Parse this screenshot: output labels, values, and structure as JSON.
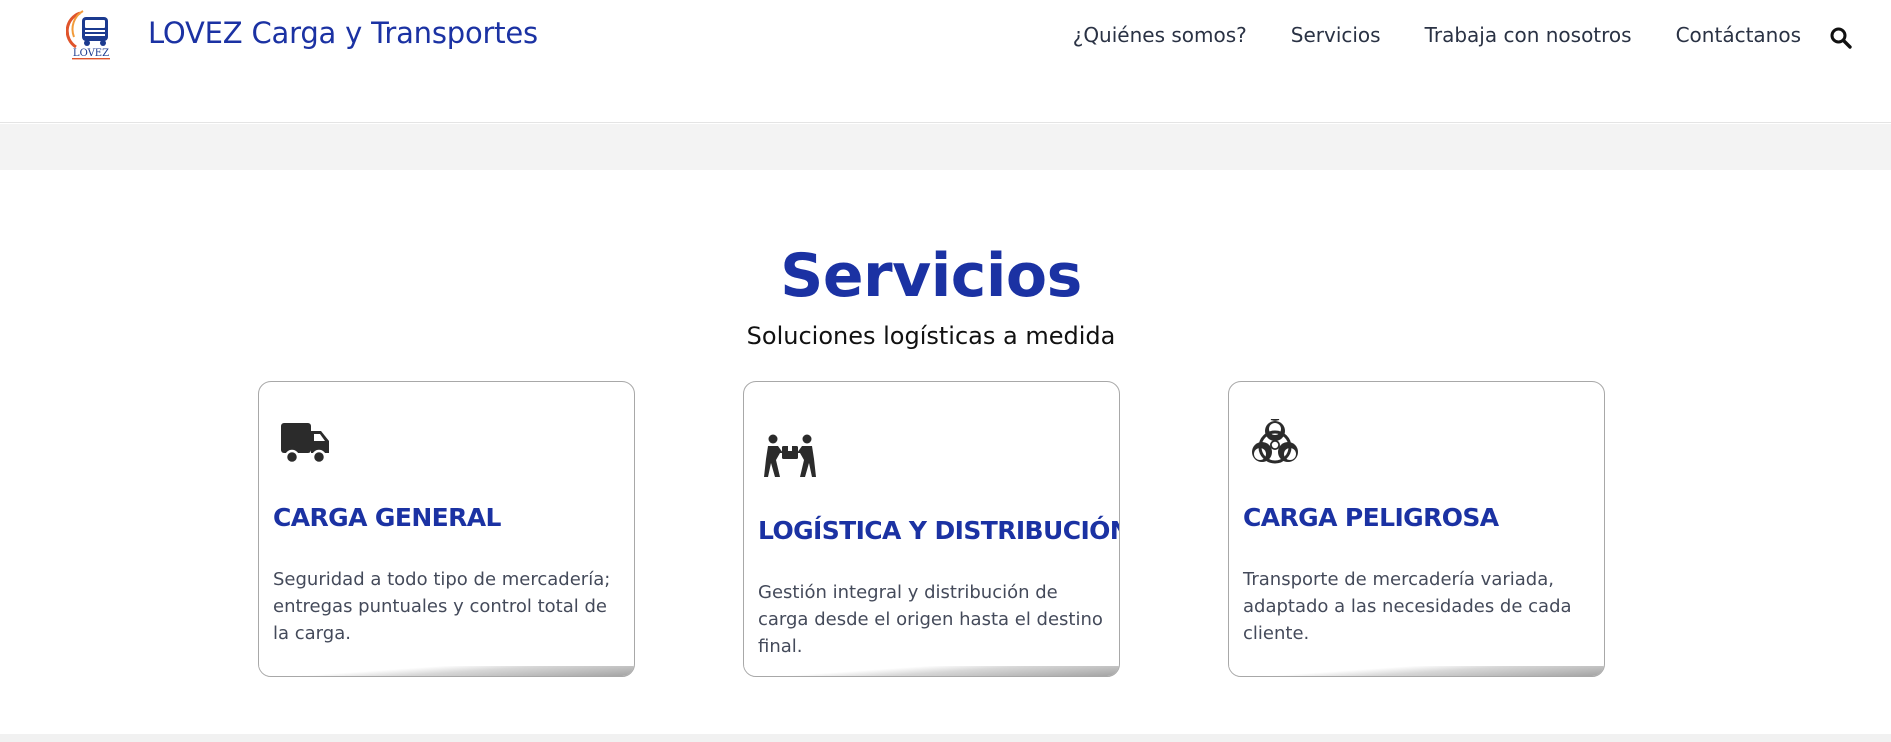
{
  "header": {
    "site_title": "LOVEZ Carga y Transportes",
    "logo_text": "LOVEZ",
    "nav": [
      {
        "label": "¿Quiénes somos?"
      },
      {
        "label": "Servicios"
      },
      {
        "label": "Trabaja con nosotros"
      },
      {
        "label": "Contáctanos"
      }
    ],
    "search_icon": "search-icon"
  },
  "section": {
    "title": "Servicios",
    "subtitle": "Soluciones logísticas a medida"
  },
  "cards": [
    {
      "icon": "truck-icon",
      "title": "CARGA GENERAL",
      "description": "Seguridad a todo tipo de mercadería; entregas puntuales y control total de la carga."
    },
    {
      "icon": "people-carry-box-icon",
      "title": "LOGÍSTICA Y DISTRIBUCIÓN",
      "description": "Gestión integral y distribución de carga desde el origen hasta el destino final."
    },
    {
      "icon": "biohazard-icon",
      "title": "CARGA PELIGROSA",
      "description": "Transporte de mercadería variada, adaptado a las necesidades de cada cliente."
    }
  ],
  "colors": {
    "brand_blue": "#1b32a3",
    "nav_text": "#2a3244",
    "band_gray": "#f3f3f3"
  }
}
